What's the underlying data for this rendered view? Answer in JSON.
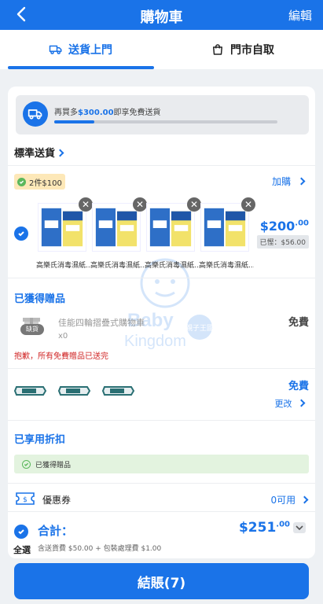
{
  "header": {
    "title": "購物車",
    "edit_label": "編輯",
    "colors": {
      "brand": "#1a73e8"
    }
  },
  "tabs": [
    {
      "label": "送貨上門",
      "active": true
    },
    {
      "label": "門市自取",
      "active": false
    }
  ],
  "shipping": {
    "prefix": "再買多",
    "amount": "$300.00",
    "suffix": "即享免費送貨",
    "progress_fraction": 0.18
  },
  "standard": {
    "title": "標準送貨",
    "promo_badge": "2件$100",
    "addon_label": "加購",
    "products": [
      {
        "name": "高樂氏消毒濕紙..."
      },
      {
        "name": "高樂氏消毒濕紙..."
      },
      {
        "name": "高樂氏消毒濕紙..."
      },
      {
        "name": "高樂氏消毒濕紙..."
      }
    ],
    "price_main": "$200",
    "price_cents": ".00",
    "saved": "已慳：$56.00"
  },
  "gifts": {
    "title": "已獲得贈品",
    "item1_name": "佳能四輪摺疊式購物車",
    "item1_qty": "x0",
    "item1_badge": "缺貨",
    "item1_price": "免費",
    "warning": "抱歉，所有免費贈品已送完",
    "item2_price": "免費",
    "change_label": "更改"
  },
  "discount": {
    "title": "已享用折扣",
    "banner": "已獲得贈品"
  },
  "coupon": {
    "label": "優惠券",
    "available": "0可用"
  },
  "watermark": {
    "line1": "Baby",
    "line2": "Kingdom",
    "badge": "親子王國"
  },
  "total": {
    "label": "合計：",
    "price": "$251",
    "cents": ".00",
    "sub": "含送貨費 $50.00 + 包裝處理費 $1.00",
    "select_all": "全選"
  },
  "checkout_label": "結賬(7)"
}
